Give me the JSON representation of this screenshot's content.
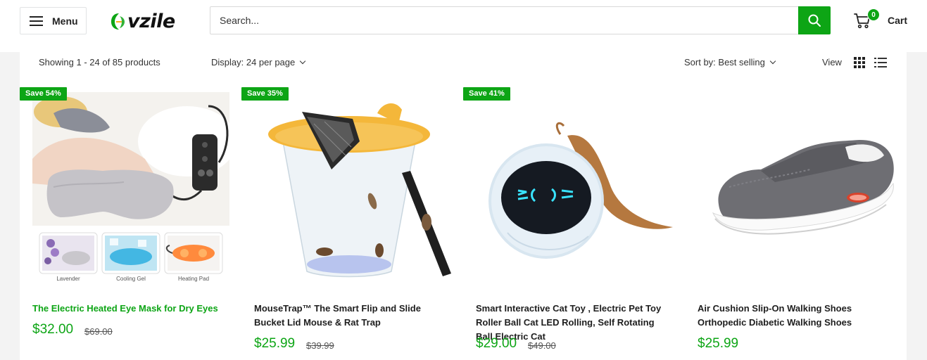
{
  "header": {
    "menu_label": "Menu",
    "logo_text": "vzile",
    "search_placeholder": "Search...",
    "cart_label": "Cart",
    "cart_count": "0",
    "accent_color": "#0da515"
  },
  "toolbar": {
    "showing": "Showing 1 - 24 of 85 products",
    "display": "Display: 24 per page",
    "sort": "Sort by: Best selling",
    "view_label": "View",
    "icons": [
      "grid-view-icon",
      "list-view-icon"
    ]
  },
  "products": [
    {
      "badge": "Save 54%",
      "title": "The Electric Heated Eye Mask for Dry Eyes",
      "price": "$32.00",
      "compare_price": "$69.00",
      "thumb_labels": [
        "Lavender",
        "Cooling Gel",
        "Heating Pad"
      ]
    },
    {
      "badge": "Save 35%",
      "title": "MouseTrap™ The Smart Flip and Slide Bucket Lid Mouse & Rat Trap",
      "price": "$25.99",
      "compare_price": "$39.99"
    },
    {
      "badge": "Save 41%",
      "title": "Smart Interactive Cat Toy , Electric Pet Toy Roller Ball Cat LED Rolling, Self Rotating Ball Electric Cat",
      "price": "$29.00",
      "compare_price": "$49.00"
    },
    {
      "badge": "",
      "title": "Air Cushion Slip-On Walking Shoes Orthopedic Diabetic Walking Shoes",
      "price": "$25.99",
      "compare_price": ""
    }
  ]
}
